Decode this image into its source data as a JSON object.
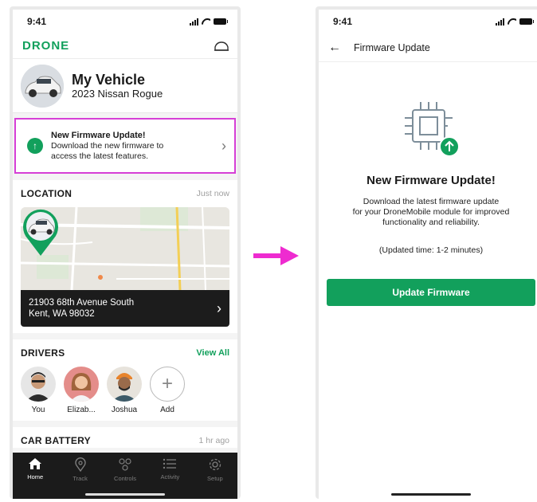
{
  "colors": {
    "brand_green": "#12a05c",
    "highlight_magenta": "#d63fd6",
    "arrow_magenta": "#ee2bd0",
    "tab_bar": "#1b1b1b"
  },
  "left_screen": {
    "status_time": "9:41",
    "brand": "DRONE",
    "header_icon": "car-outline-icon",
    "vehicle": {
      "name": "My Vehicle",
      "model": "2023 Nissan Rogue"
    },
    "firmware_banner": {
      "icon": "arrow-up-icon",
      "title": "New Firmware Update!",
      "body_line1": "Download the new firmware to",
      "body_line2": "access the latest features."
    },
    "location": {
      "title": "LOCATION",
      "updated": "Just now",
      "address_line1": "21903 68th Avenue South",
      "address_line2": "Kent, WA 98032"
    },
    "drivers": {
      "title": "DRIVERS",
      "view_all": "View All",
      "people": [
        {
          "name": "You"
        },
        {
          "name": "Elizab..."
        },
        {
          "name": "Joshua"
        }
      ],
      "add_label": "Add"
    },
    "car_battery": {
      "title": "CAR BATTERY",
      "updated": "1 hr ago"
    },
    "tabs": [
      {
        "label": "Home",
        "icon": "home-icon",
        "active": true
      },
      {
        "label": "Track",
        "icon": "location-pin-icon",
        "active": false
      },
      {
        "label": "Controls",
        "icon": "controls-icon",
        "active": false
      },
      {
        "label": "Activity",
        "icon": "list-icon",
        "active": false
      },
      {
        "label": "Setup",
        "icon": "gear-icon",
        "active": false
      }
    ]
  },
  "right_screen": {
    "status_time": "9:41",
    "nav_title": "Firmware Update",
    "chip_icon": "chip-with-update-icon",
    "title": "New Firmware Update!",
    "body_line1": "Download the latest firmware update",
    "body_line2": "for your DroneMobile module for improved",
    "body_line3": "functionality and reliability.",
    "updated_time": "(Updated time: 1-2 minutes)",
    "button_label": "Update Firmware"
  }
}
